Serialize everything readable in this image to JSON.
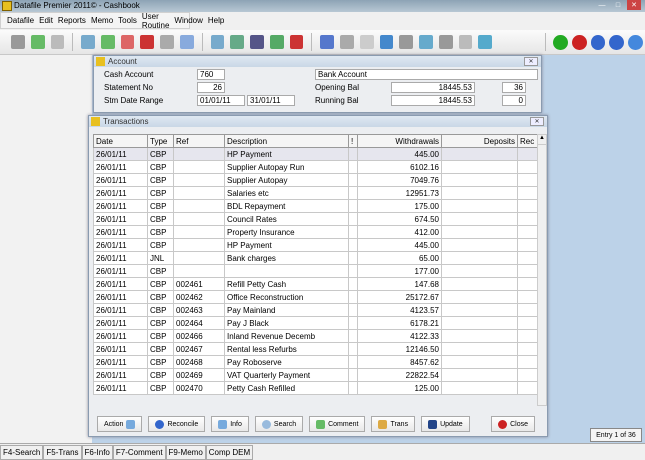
{
  "app": {
    "title": "Datafile  Premier 2011© - Cashbook"
  },
  "menu": [
    "Datafile",
    "Edit",
    "Reports",
    "Memo",
    "Tools",
    "User Routine",
    "Window",
    "Help"
  ],
  "account": {
    "window_title": "Account",
    "cash_account_label": "Cash Account",
    "cash_account": "760",
    "account_name": "Bank Account",
    "statement_no_label": "Statement No",
    "statement_no": "26",
    "date_range_label": "Stm Date Range",
    "date_from": "01/01/11",
    "date_to": "31/01/11",
    "opening_bal_label": "Opening Bal",
    "opening_bal": "18445.53",
    "opening_count": "36",
    "running_bal_label": "Running Bal",
    "running_bal": "18445.53",
    "running_count": "0"
  },
  "transactions": {
    "window_title": "Transactions",
    "columns": [
      "Date",
      "Type",
      "Ref",
      "Description",
      "!",
      "Withdrawals",
      "Deposits",
      "Rec"
    ],
    "rows": [
      [
        "26/01/11",
        "CBP",
        "",
        "HP Payment",
        "",
        "445.00",
        "",
        ""
      ],
      [
        "26/01/11",
        "CBP",
        "",
        "Supplier Autopay Run",
        "",
        "6102.16",
        "",
        ""
      ],
      [
        "26/01/11",
        "CBP",
        "",
        "Supplier Autopay",
        "",
        "7049.76",
        "",
        ""
      ],
      [
        "26/01/11",
        "CBP",
        "",
        "Salaries etc",
        "",
        "12951.73",
        "",
        ""
      ],
      [
        "26/01/11",
        "CBP",
        "",
        "BDL Repayment",
        "",
        "175.00",
        "",
        ""
      ],
      [
        "26/01/11",
        "CBP",
        "",
        "Council Rates",
        "",
        "674.50",
        "",
        ""
      ],
      [
        "26/01/11",
        "CBP",
        "",
        "Property Insurance",
        "",
        "412.00",
        "",
        ""
      ],
      [
        "26/01/11",
        "CBP",
        "",
        "HP Payment",
        "",
        "445.00",
        "",
        ""
      ],
      [
        "26/01/11",
        "JNL",
        "",
        "Bank charges",
        "",
        "65.00",
        "",
        ""
      ],
      [
        "26/01/11",
        "CBP",
        "",
        "",
        "",
        "177.00",
        "",
        ""
      ],
      [
        "26/01/11",
        "CBP",
        "002461",
        "Refill Petty Cash",
        "",
        "147.68",
        "",
        ""
      ],
      [
        "26/01/11",
        "CBP",
        "002462",
        "Office Reconstruction",
        "",
        "25172.67",
        "",
        ""
      ],
      [
        "26/01/11",
        "CBP",
        "002463",
        "Pay Mainland",
        "",
        "4123.57",
        "",
        ""
      ],
      [
        "26/01/11",
        "CBP",
        "002464",
        "Pay J Black",
        "",
        "6178.21",
        "",
        ""
      ],
      [
        "26/01/11",
        "CBP",
        "002466",
        "Inland Revenue Decemb",
        "",
        "4122.33",
        "",
        ""
      ],
      [
        "26/01/11",
        "CBP",
        "002467",
        "Rental less Refurbs",
        "",
        "12146.50",
        "",
        ""
      ],
      [
        "26/01/11",
        "CBP",
        "002468",
        "Pay Roboserve",
        "",
        "8457.62",
        "",
        ""
      ],
      [
        "26/01/11",
        "CBP",
        "002469",
        "VAT Quarterly Payment",
        "",
        "22822.54",
        "",
        ""
      ],
      [
        "26/01/11",
        "CBP",
        "002470",
        "Petty Cash Refilled",
        "",
        "125.00",
        "",
        ""
      ]
    ]
  },
  "buttons": {
    "action": "Action",
    "reconcile": "Reconcile",
    "info": "Info",
    "search": "Search",
    "comment": "Comment",
    "trans": "Trans",
    "update": "Update",
    "close": "Close"
  },
  "status": {
    "items": [
      "F4-Search",
      "F5-Trans",
      "F6-Info",
      "F7-Comment",
      "F9-Memo",
      "Comp DEM"
    ],
    "entry": "Entry 1 of 36"
  }
}
